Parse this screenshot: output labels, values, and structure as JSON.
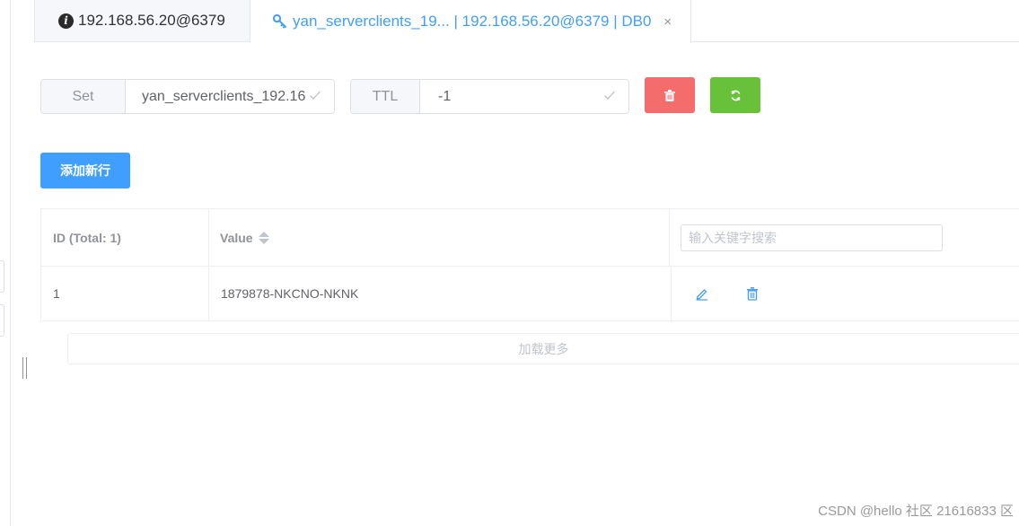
{
  "tabs": [
    {
      "label": "192.168.56.20@6379",
      "icon": "info-icon",
      "active": false
    },
    {
      "label": "yan_serverclients_19... | 192.168.56.20@6379 | DB0",
      "icon": "key-icon",
      "active": true,
      "close": "×"
    }
  ],
  "key_bar": {
    "type_label": "Set",
    "key_name": "yan_serverclients_192.16",
    "ttl_label": "TTL",
    "ttl_value": "-1"
  },
  "buttons": {
    "add_row": "添加新行",
    "load_more": "加载更多"
  },
  "table": {
    "columns": [
      "ID (Total: 1)",
      "Value"
    ],
    "search_placeholder": "输入关键字搜索",
    "rows": [
      {
        "id": "1",
        "value": "1879878-NKCNO-NKNK"
      }
    ]
  },
  "watermark": "CSDN @hello 社区 21616833 区",
  "colors": {
    "primary": "#409eff",
    "danger": "#f56c6c",
    "success": "#67c23a"
  }
}
